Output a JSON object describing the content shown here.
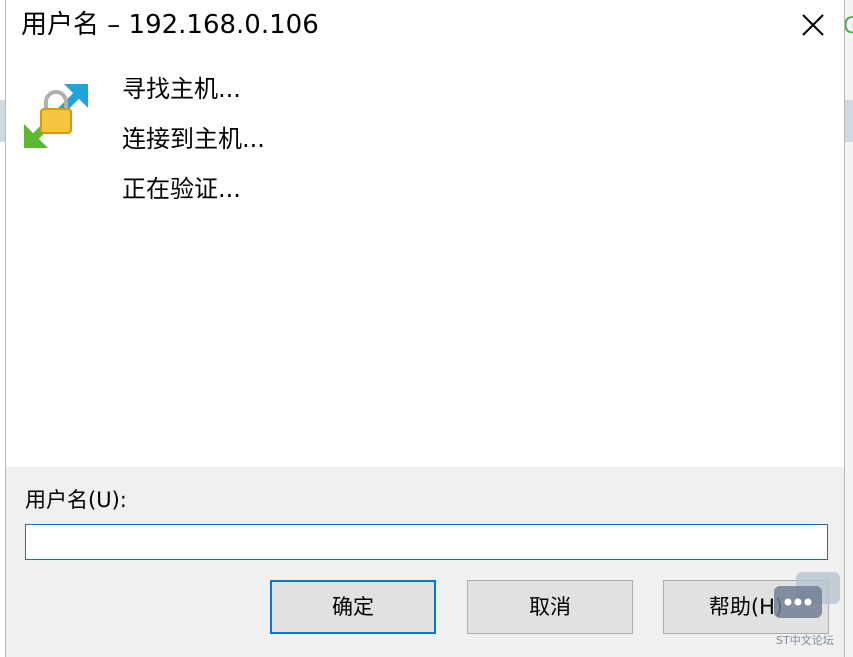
{
  "window": {
    "title": "用户名 – 192.168.0.106"
  },
  "status": {
    "lines": [
      "寻找主机...",
      "连接到主机...",
      "正在验证..."
    ]
  },
  "form": {
    "username_label": "用户名(U):",
    "username_value": "",
    "username_placeholder": ""
  },
  "buttons": {
    "ok": "确定",
    "cancel": "取消",
    "help": "帮助(H)"
  },
  "watermark": {
    "text": "ST中文论坛"
  },
  "icons": {
    "close": "close-icon",
    "connection": "lock-connection-icon"
  },
  "colors": {
    "accent": "#0078d7",
    "footer_bg": "#f0f0f0",
    "button_bg": "#e1e1e1"
  }
}
